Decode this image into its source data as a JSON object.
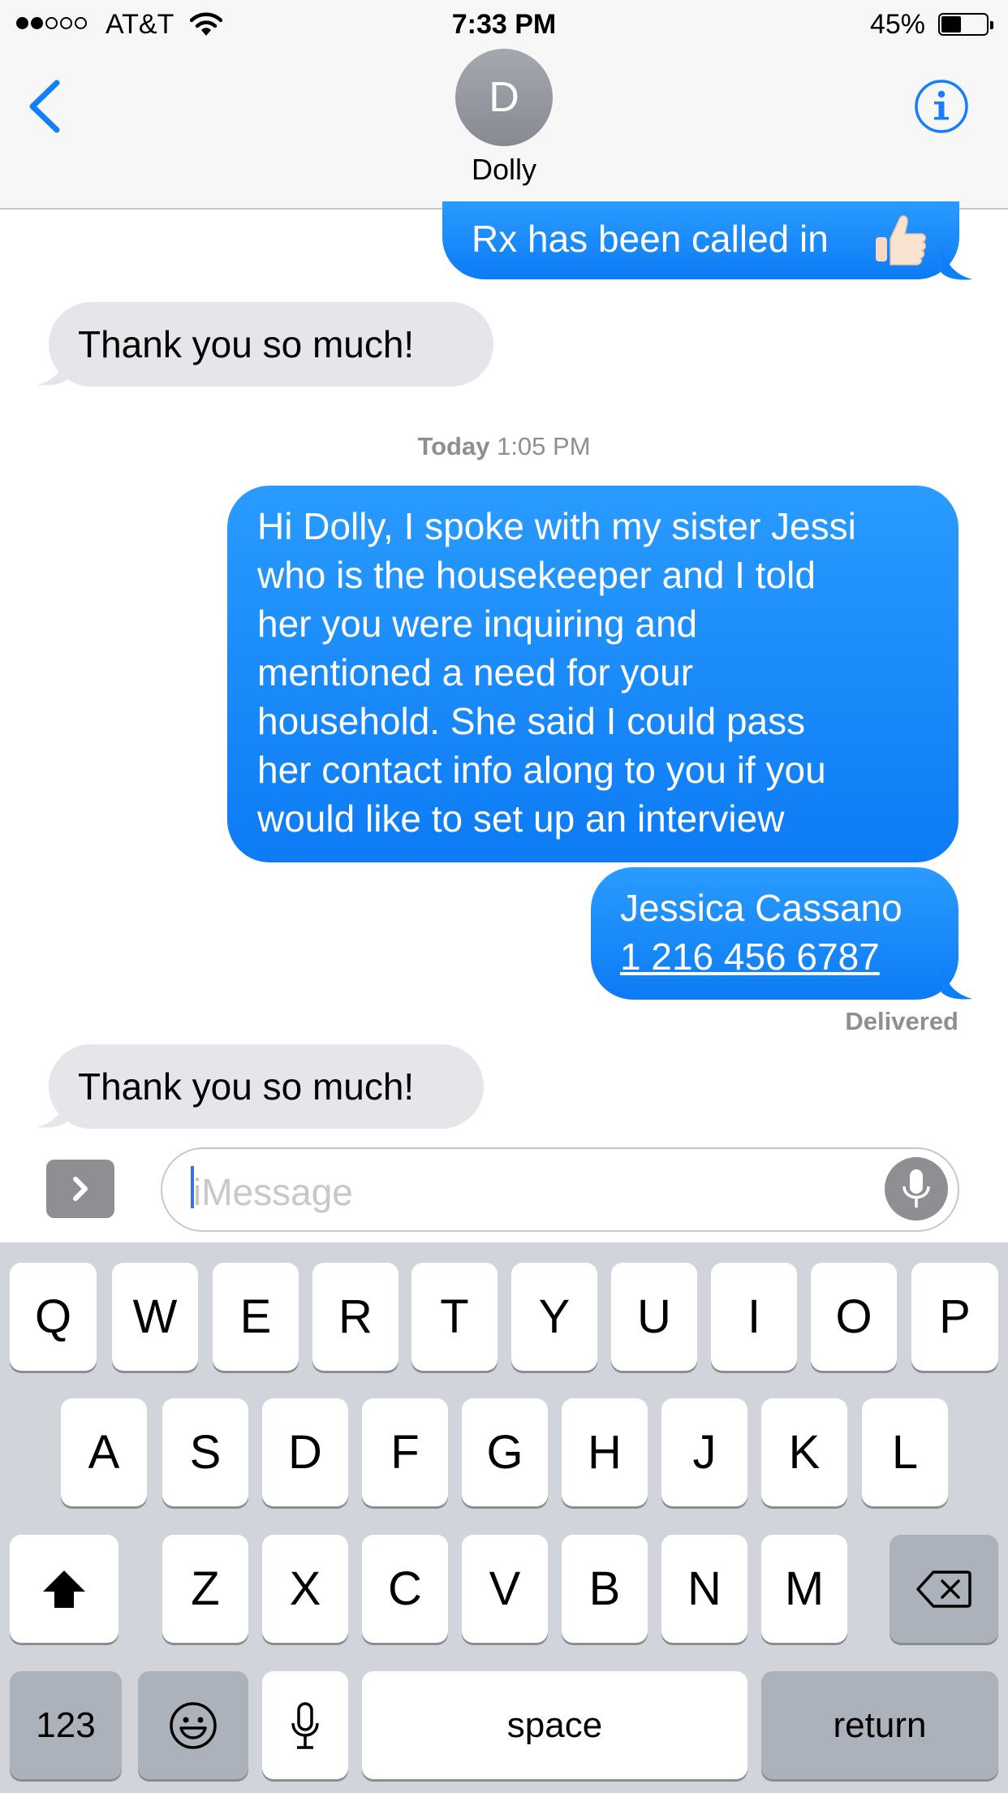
{
  "status_bar": {
    "carrier": "AT&T",
    "signal_bars_filled": 2,
    "signal_bars_total": 5,
    "time": "7:33 PM",
    "battery_percent": "45%",
    "battery_level": 0.45
  },
  "header": {
    "avatar_initial": "D",
    "contact_name": "Dolly"
  },
  "messages": {
    "m1_text": "Rx has been called in",
    "m2_text": "Thank you so much!",
    "timestamp_day": "Today",
    "timestamp_time": "1:05 PM",
    "m3_lines": [
      "Hi Dolly, I spoke with my sister Jessi",
      "who is the housekeeper and I told",
      "her you were inquiring and",
      "mentioned a need for your",
      "household. She said I could pass",
      "her contact info along to you if you",
      "would like to set up an interview"
    ],
    "m4_name": "Jessica Cassano",
    "m4_phone": "1 216 456 6787",
    "delivered": "Delivered",
    "m5_text": "Thank you so much!"
  },
  "input": {
    "placeholder": "iMessage"
  },
  "keyboard": {
    "row1": [
      "Q",
      "W",
      "E",
      "R",
      "T",
      "Y",
      "U",
      "I",
      "O",
      "P"
    ],
    "row2": [
      "A",
      "S",
      "D",
      "F",
      "G",
      "H",
      "J",
      "K",
      "L"
    ],
    "row3": [
      "Z",
      "X",
      "C",
      "V",
      "B",
      "N",
      "M"
    ],
    "numbers_label": "123",
    "space_label": "space",
    "return_label": "return"
  },
  "colors": {
    "accent": "#147efb",
    "outgoing_bubble": "#1a8cff",
    "incoming_bubble": "#e5e5ea",
    "keyboard_bg": "#d1d4da",
    "muted_text": "#8e8e93"
  },
  "icons": {
    "back": "chevron-left-icon",
    "info": "info-icon",
    "apps": "chevron-right-icon",
    "mic": "microphone-icon",
    "shift": "shift-arrow-icon",
    "delete": "backspace-icon",
    "emoji": "smiley-icon",
    "wifi": "wifi-icon",
    "thumbs_up": "thumbs-up-emoji"
  }
}
